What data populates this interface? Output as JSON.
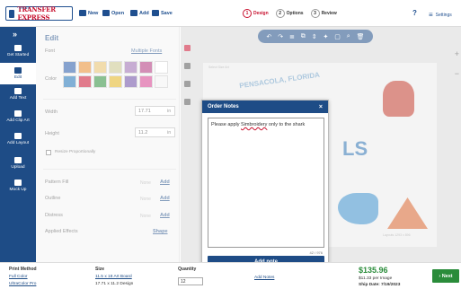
{
  "header": {
    "logo_text": "TRANSFER EXPRESS",
    "logo_subtext": "STAHLS",
    "toolbar": {
      "new": "New",
      "open": "Open",
      "add": "Add",
      "save": "Save"
    },
    "steps": [
      {
        "num": "1",
        "label": "Design",
        "active": true
      },
      {
        "num": "2",
        "label": "Options",
        "active": false
      },
      {
        "num": "3",
        "label": "Review",
        "active": false
      }
    ],
    "help": "?",
    "settings": "Settings"
  },
  "leftnav": {
    "collapse": "»",
    "items": [
      {
        "label": "Get Started",
        "icon": "home-icon"
      },
      {
        "label": "Edit",
        "icon": "pencil-icon",
        "active": true
      },
      {
        "label": "Add Text",
        "icon": "text-icon"
      },
      {
        "label": "Add Clip Art",
        "icon": "image-icon"
      },
      {
        "label": "Add Layout",
        "icon": "layout-icon"
      },
      {
        "label": "Upload",
        "icon": "upload-icon"
      },
      {
        "label": "Mock Up",
        "icon": "shirt-icon"
      }
    ]
  },
  "edit_panel": {
    "title": "Edit",
    "font_label": "Font",
    "font_value": "Multiple Fonts",
    "color_label": "Color",
    "colors": [
      "#2456a6",
      "#e88b2c",
      "#e5c06a",
      "#c9c58a",
      "#9a6bb0",
      "#b0327a",
      "#ffffff",
      "#1a6fb5",
      "#c8102e",
      "#2a8c3a",
      "#e2b31d",
      "#6b4aa3",
      "#d43c8c",
      "#f2f2f2"
    ],
    "width_label": "Width",
    "width_value": "17.71",
    "height_label": "Height",
    "height_value": "11.2",
    "unit": "in",
    "resize_label": "Resize Proportionally",
    "rows": [
      {
        "label": "Pattern Fill",
        "value": "None",
        "action": "Add"
      },
      {
        "label": "Outline",
        "value": "None",
        "action": "Add"
      },
      {
        "label": "Distress",
        "value": "None",
        "action": "Add"
      },
      {
        "label": "Applied Effects",
        "value": "",
        "action": "Shape"
      }
    ]
  },
  "canvas": {
    "shirt_label": "Select Size Art",
    "design_text_1": "PENSACOLA, FLORIDA",
    "design_text_2": "LS",
    "watermark": "Layouts 1293 x 896"
  },
  "modal": {
    "title": "Order Notes",
    "close": "×",
    "text_before": "Please apply ",
    "text_misspelled": "Simbroidery",
    "text_after": " only to the shark",
    "counter": "42 / 976",
    "button": "Add note"
  },
  "bottom": {
    "print_method_label": "Print Method",
    "print_method_1": "Full Color",
    "print_method_2": "UltraColor Pro",
    "size_label": "Size",
    "size_1": "11.5 x 18 Art Board",
    "size_2": "17.71 x 11.2 Design",
    "quantity_label": "Quantity",
    "quantity_value": "12",
    "add_notes": "Add Notes",
    "price": "$135.96",
    "per_image": "$11.33 per Image",
    "ship_date": "Ship Date: 7/19/2023",
    "next": "Next"
  },
  "colors": {
    "brand_blue": "#1e4c86",
    "brand_red": "#c8102e",
    "price_green": "#2a8c3a"
  }
}
